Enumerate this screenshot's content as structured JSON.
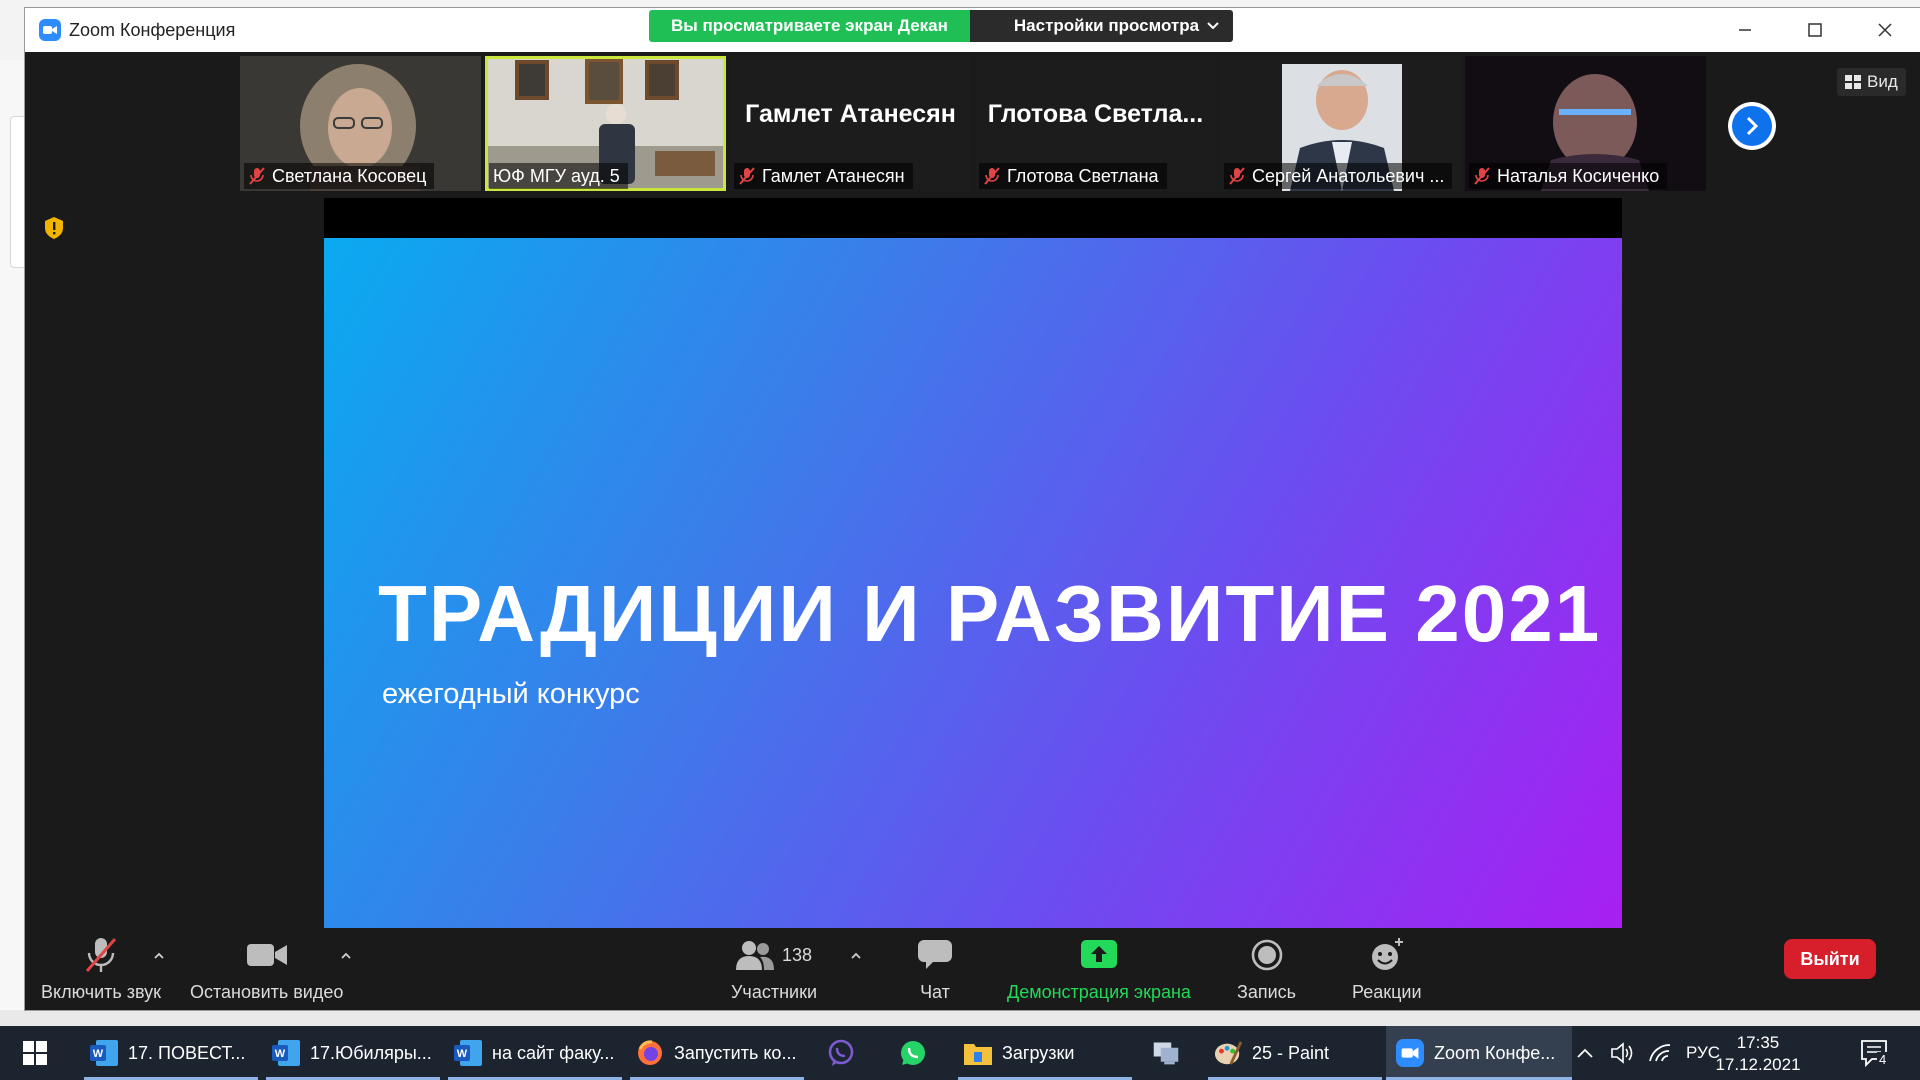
{
  "window": {
    "title": "Zoom Конференция",
    "banner_viewing": "Вы просматриваете экран Декан",
    "banner_options": "Настройки просмотра"
  },
  "participants_strip": [
    {
      "name": "Светлана Косовец",
      "muted": true,
      "video": true
    },
    {
      "name": "ЮФ МГУ ауд. 5",
      "muted": false,
      "video": true,
      "active": true
    },
    {
      "name": "Гамлет Атанесян",
      "display": "Гамлет Атанесян",
      "muted": true,
      "video": false
    },
    {
      "name": "Глотова Светлана",
      "display": "Глотова  Светла...",
      "muted": true,
      "video": false
    },
    {
      "name": "Сергей Анатольевич ...",
      "muted": true,
      "video": true
    },
    {
      "name": "Наталья Косиченко",
      "muted": true,
      "video": true
    }
  ],
  "view_button": "Вид",
  "slide": {
    "title": "ТРАДИЦИИ И РАЗВИТИЕ 2021",
    "subtitle": "ежегодный конкурс"
  },
  "toolbar": {
    "unmute": "Включить звук",
    "stop_video": "Остановить видео",
    "participants": "Участники",
    "participants_count": "138",
    "chat": "Чат",
    "share": "Демонстрация экрана",
    "record": "Запись",
    "reactions": "Реакции",
    "leave": "Выйти"
  },
  "taskbar": {
    "items": [
      {
        "label": "17. ПОВЕСТ...",
        "icon": "word-icon"
      },
      {
        "label": "17.Юбиляры...",
        "icon": "word-icon"
      },
      {
        "label": "на сайт факу...",
        "icon": "word-icon"
      },
      {
        "label": "Запустить ко...",
        "icon": "firefox-icon"
      },
      {
        "label": "",
        "icon": "viber-icon"
      },
      {
        "label": "",
        "icon": "whatsapp-icon"
      },
      {
        "label": "Загрузки",
        "icon": "folder-icon"
      },
      {
        "label": "",
        "icon": "network-icon"
      },
      {
        "label": "25 - Paint",
        "icon": "paint-icon"
      },
      {
        "label": "Zoom Конфе...",
        "icon": "zoom-icon"
      }
    ],
    "language": "РУС",
    "time": "17:35",
    "date": "17.12.2021",
    "notifications": "4"
  },
  "colors": {
    "zoom_blue": "#2d8cff",
    "banner_green": "#1fbf56",
    "leave_red": "#d71e2b",
    "share_green": "#23d959"
  }
}
